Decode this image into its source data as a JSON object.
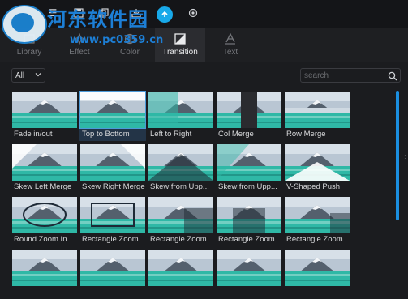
{
  "watermark": {
    "title": "河东软件园",
    "url": "www.pc0359.cn"
  },
  "tabs": [
    {
      "label": "Library",
      "icon": "library-icon",
      "active": false
    },
    {
      "label": "Effect",
      "icon": "effect-icon",
      "active": false
    },
    {
      "label": "Color",
      "icon": "color-icon",
      "active": false
    },
    {
      "label": "Transition",
      "icon": "transition-icon",
      "active": true
    },
    {
      "label": "Text",
      "icon": "text-icon",
      "active": false
    }
  ],
  "filter": {
    "value": "All"
  },
  "search": {
    "placeholder": "search"
  },
  "transitions": [
    {
      "label": "Fade in/out",
      "selected": false
    },
    {
      "label": "Top to Bottom",
      "selected": true
    },
    {
      "label": "Left to Right",
      "selected": false
    },
    {
      "label": "Col Merge",
      "selected": false
    },
    {
      "label": "Row Merge",
      "selected": false
    },
    {
      "label": "Skew Left Merge",
      "selected": false
    },
    {
      "label": "Skew Right Merge",
      "selected": false
    },
    {
      "label": "Skew from Upp...",
      "selected": false
    },
    {
      "label": "Skew from Upp...",
      "selected": false
    },
    {
      "label": "V-Shaped Push",
      "selected": false
    },
    {
      "label": "Round Zoom In",
      "selected": false
    },
    {
      "label": "Rectangle Zoom...",
      "selected": false
    },
    {
      "label": "Rectangle Zoom...",
      "selected": false
    },
    {
      "label": "Rectangle Zoom...",
      "selected": false
    },
    {
      "label": "Rectangle Zoom...",
      "selected": false
    },
    {
      "label": "",
      "selected": false
    },
    {
      "label": "",
      "selected": false
    },
    {
      "label": "",
      "selected": false
    },
    {
      "label": "",
      "selected": false
    },
    {
      "label": "",
      "selected": false
    }
  ],
  "colors": {
    "accent": "#1b8fe0",
    "selected_bg": "#233447",
    "teal": "#2fb8a6"
  }
}
